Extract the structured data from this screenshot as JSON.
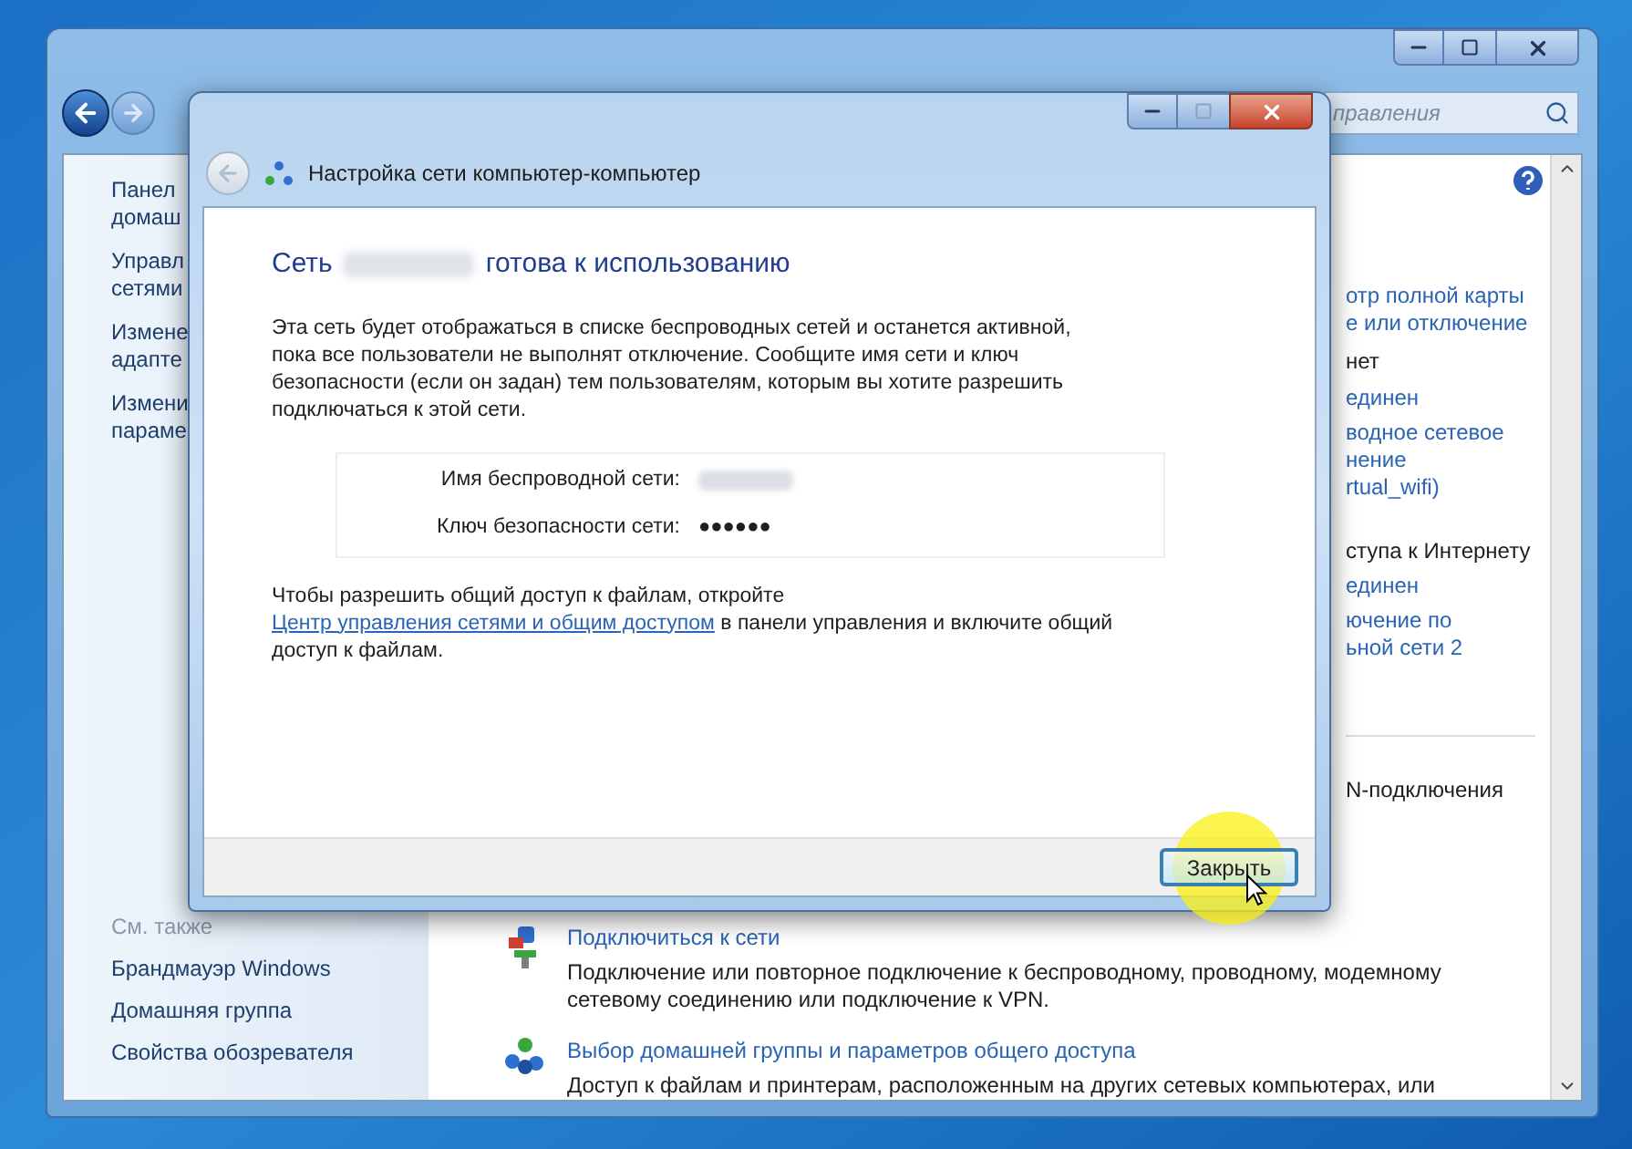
{
  "control_panel": {
    "search": {
      "placeholder": "правления"
    },
    "sidebar": {
      "items": [
        [
          "Панел",
          "домаш"
        ],
        [
          "Управл",
          "сетями"
        ],
        [
          "Измене",
          "адапте"
        ],
        [
          "Измени",
          "параме"
        ]
      ],
      "see_also": {
        "title": "См. также",
        "items": [
          "Брандмауэр Windows",
          "Домашняя группа",
          "Свойства обозревателя"
        ]
      }
    },
    "right_fragments": [
      {
        "text": "отр полной карты",
        "kind": "link"
      },
      {
        "text": "е или отключение",
        "kind": "link"
      },
      {
        "text": "нет",
        "kind": "text"
      },
      {
        "text": "единен",
        "kind": "link"
      },
      {
        "text": "водное сетевое",
        "kind": "link"
      },
      {
        "text": "нение",
        "kind": "link"
      },
      {
        "text": "rtual_wifi)",
        "kind": "link"
      },
      {
        "text": "ступа к Интернету",
        "kind": "text"
      },
      {
        "text": "единен",
        "kind": "link"
      },
      {
        "text": "ючение по",
        "kind": "link"
      },
      {
        "text": "ьной сети 2",
        "kind": "link"
      },
      {
        "text": "N-подключения",
        "kind": "text"
      }
    ],
    "tasks": [
      {
        "title": "Подключиться к сети",
        "description": "Подключение или повторное подключение к беспроводному, проводному, модемному сетевому соединению или подключение к VPN."
      },
      {
        "title": "Выбор домашней группы и параметров общего доступа",
        "description": "Доступ к файлам и принтерам, расположенным на других сетевых компьютерах, или"
      }
    ]
  },
  "dialog": {
    "title": "Настройка сети компьютер-компьютер",
    "heading_start": "Сеть",
    "heading_end": "готова к использованию",
    "paragraph": "Эта сеть будет отображаться в списке беспроводных сетей и останется активной, пока все пользователи не выполнят отключение. Сообщите имя сети и ключ безопасности (если он задан) тем пользователям, которым вы хотите разрешить подключаться к этой сети.",
    "fields": [
      {
        "label": "Имя беспроводной сети:",
        "kind": "redacted"
      },
      {
        "label": "Ключ безопасности сети:",
        "kind": "text",
        "value": "●●●●●●"
      }
    ],
    "share": {
      "before": "Чтобы разрешить общий доступ к файлам, откройте",
      "link": "Центр управления сетями и общим доступом",
      "after": "в панели управления и включите общий доступ к файлам."
    },
    "button": {
      "label": "Закрыть",
      "default": true
    }
  }
}
